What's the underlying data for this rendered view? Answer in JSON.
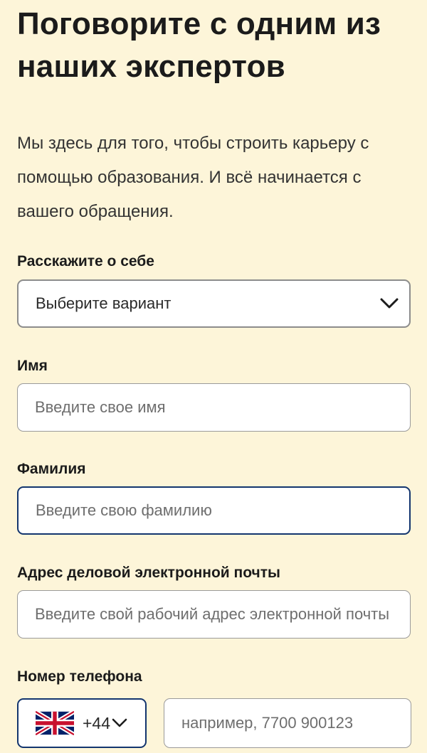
{
  "heading": {
    "title": "Поговорите с одним из наших экспертов",
    "intro": "Мы здесь для того, чтобы строить карьеру с помощью образования. И всё начинается с вашего обращения."
  },
  "form": {
    "about": {
      "label": "Расскажите о себе",
      "selected": "Выберите вариант",
      "icon": "chevron-down-icon"
    },
    "first_name": {
      "label": "Имя",
      "placeholder": "Введите свое имя"
    },
    "last_name": {
      "label": "Фамилия",
      "placeholder": "Введите свою фамилию"
    },
    "email": {
      "label": "Адрес деловой электронной почты",
      "placeholder": "Введите свой рабочий адрес электронной почты"
    },
    "phone": {
      "label": "Номер телефона",
      "country_code": "+44",
      "flag_icon": "uk-flag-icon",
      "placeholder": "например, 7700 900123"
    }
  },
  "colors": {
    "background": "#fdf5d9",
    "focus_border": "#13356e"
  }
}
